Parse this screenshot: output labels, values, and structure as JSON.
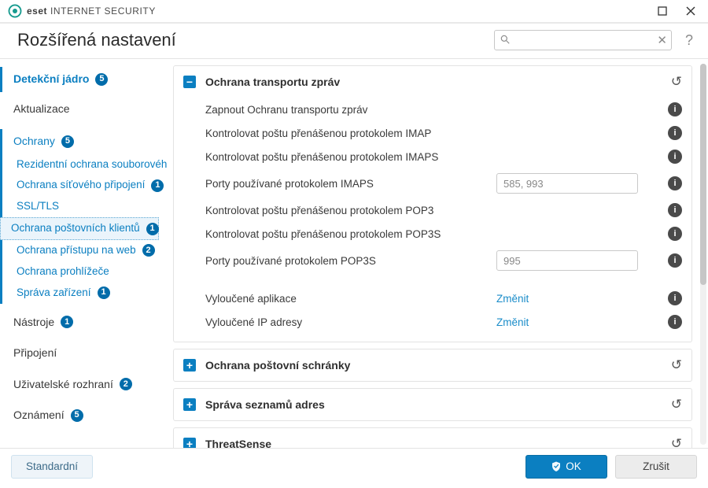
{
  "brand": {
    "name_bold": "eset",
    "name_rest": "INTERNET SECURITY"
  },
  "header": {
    "title": "Rozšířená nastavení"
  },
  "search": {
    "placeholder": ""
  },
  "sidebar": {
    "top": [
      {
        "label": "Detekční jádro",
        "badge": "5",
        "active": true
      },
      {
        "label": "Aktualizace"
      }
    ],
    "protections": {
      "header": {
        "label": "Ochrany",
        "badge": "5"
      },
      "items": [
        {
          "label": "Rezidentní ochrana souborového systému"
        },
        {
          "label": "Ochrana síťového připojení",
          "badge": "1"
        },
        {
          "label": "SSL/TLS"
        },
        {
          "label": "Ochrana poštovních klientů",
          "badge": "1",
          "selected": true
        },
        {
          "label": "Ochrana přístupu na web",
          "badge": "2"
        },
        {
          "label": "Ochrana prohlížeče"
        },
        {
          "label": "Správa zařízení",
          "badge": "1"
        }
      ]
    },
    "bottom": [
      {
        "label": "Nástroje",
        "badge": "1"
      },
      {
        "label": "Připojení"
      },
      {
        "label": "Uživatelské rozhraní",
        "badge": "2"
      },
      {
        "label": "Oznámení",
        "badge": "5"
      }
    ]
  },
  "panels": {
    "transport": {
      "title": "Ochrana transportu zpráv",
      "rows": {
        "enable": {
          "label": "Zapnout Ochranu transportu zpráv"
        },
        "imap": {
          "label": "Kontrolovat poštu přenášenou protokolem IMAP"
        },
        "imaps": {
          "label": "Kontrolovat poštu přenášenou protokolem IMAPS"
        },
        "imaps_ports": {
          "label": "Porty používané protokolem IMAPS",
          "value": "585, 993"
        },
        "pop3": {
          "label": "Kontrolovat poštu přenášenou protokolem POP3"
        },
        "pop3s": {
          "label": "Kontrolovat poštu přenášenou protokolem POP3S"
        },
        "pop3s_ports": {
          "label": "Porty používané protokolem POP3S",
          "value": "995"
        },
        "excl_apps": {
          "label": "Vyloučené aplikace",
          "action": "Změnit"
        },
        "excl_ips": {
          "label": "Vyloučené IP adresy",
          "action": "Změnit"
        }
      }
    },
    "mailbox": {
      "title": "Ochrana poštovní schránky"
    },
    "addrlists": {
      "title": "Správa seznamů adres"
    },
    "threatsense": {
      "title": "ThreatSense"
    }
  },
  "footer": {
    "default": "Standardní",
    "ok": "OK",
    "cancel": "Zrušit"
  }
}
